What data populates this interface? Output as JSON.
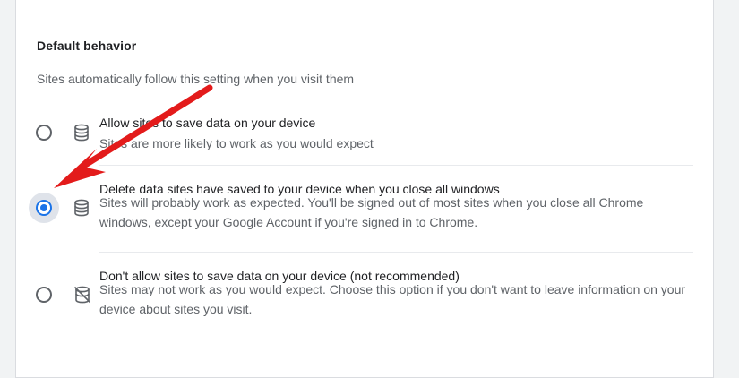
{
  "section": {
    "title": "Default behavior",
    "description": "Sites automatically follow this setting when you visit them"
  },
  "options": [
    {
      "title": "Allow sites to save data on your device",
      "description": "Sites are more likely to work as you would expect",
      "icon": "database-icon",
      "selected": false
    },
    {
      "title": "Delete data sites have saved to your device when you close all windows",
      "description": "Sites will probably work as expected. You'll be signed out of most sites when you close all Chrome windows, except your Google Account if you're signed in to Chrome.",
      "icon": "database-icon",
      "selected": true
    },
    {
      "title": "Don't allow sites to save data on your device (not recommended)",
      "description": "Sites may not work as you would expect. Choose this option if you don't want to leave information on your device about sites you visit.",
      "icon": "database-off-icon",
      "selected": false
    }
  ],
  "annotation": {
    "arrow_color": "#e31b1b",
    "icon": "red-arrow-annotation"
  },
  "colors": {
    "accent": "#1a73e8",
    "text_primary": "#202124",
    "text_secondary": "#5f6368"
  }
}
